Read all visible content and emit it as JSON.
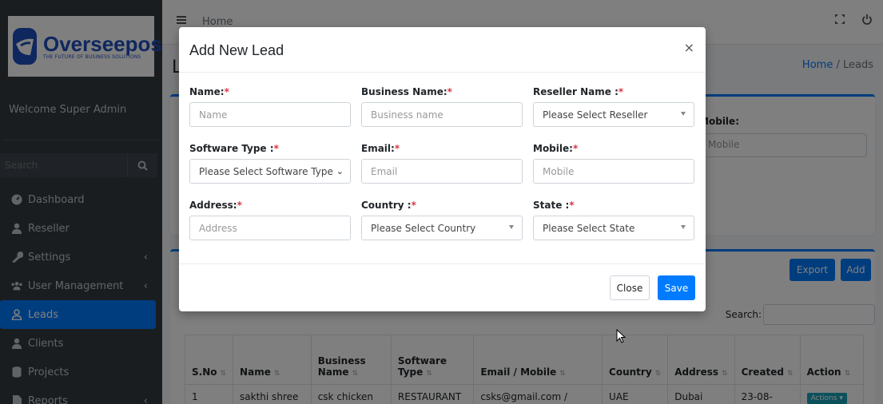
{
  "brand": {
    "name": "Overseepos",
    "tagline": "THE FUTURE OF BUSINESS SOLUTIONS",
    "color": "#1f4fbf"
  },
  "sidebar": {
    "welcome": "Welcome Super Admin",
    "search_placeholder": "Search",
    "items": [
      {
        "label": "Dashboard",
        "icon": "dashboard-icon"
      },
      {
        "label": "Reseller",
        "icon": "user-tie-icon"
      },
      {
        "label": "Settings",
        "icon": "wrench-icon"
      },
      {
        "label": "User Management",
        "icon": "users-icon"
      },
      {
        "label": "Leads",
        "icon": "user-outline-icon"
      },
      {
        "label": "Clients",
        "icon": "user-icon"
      },
      {
        "label": "Projects",
        "icon": "database-icon"
      },
      {
        "label": "Reports",
        "icon": "file-icon"
      }
    ]
  },
  "topbar": {
    "home": "Home"
  },
  "page": {
    "breadcrumb_home": "Home",
    "breadcrumb_sep": "/",
    "breadcrumb_current": "Leads",
    "filter_mobile_label": "Mobile:",
    "filter_mobile_placeholder": "Mobile",
    "export_label": "Export",
    "add_label": "Add",
    "search_label": "Search:",
    "table": {
      "headers": [
        "S.No",
        "Name",
        "Business Name",
        "Software Type",
        "Email / Mobile",
        "Country",
        "Address",
        "Created",
        "Action"
      ],
      "rows": [
        [
          "1",
          "sakthi shree",
          "csk chicken",
          "RESTAURANT",
          "csks@gmail.com /",
          "UAE",
          "Dubai",
          "23-08-",
          "Actions"
        ]
      ]
    }
  },
  "modal": {
    "title": "Add New Lead",
    "close_icon": "×",
    "fields": {
      "name": {
        "label": "Name:",
        "placeholder": "Name"
      },
      "business": {
        "label": "Business Name:",
        "placeholder": "Business name"
      },
      "reseller": {
        "label": "Reseller Name :",
        "value": "Please Select Reseller"
      },
      "software": {
        "label": "Software Type :",
        "value": "Please Select Software Type"
      },
      "email": {
        "label": "Email:",
        "placeholder": "Email"
      },
      "mobile": {
        "label": "Mobile:",
        "placeholder": "Mobile"
      },
      "address": {
        "label": "Address:",
        "placeholder": "Address"
      },
      "country": {
        "label": "Country :",
        "value": "Please Select Country"
      },
      "state": {
        "label": "State :",
        "value": "Please Select State"
      }
    },
    "required_mark": "*",
    "close_label": "Close",
    "save_label": "Save"
  },
  "colors": {
    "primary": "#007bff",
    "sidebar": "#343a40",
    "danger": "#dc3545",
    "info": "#17a2b8"
  }
}
